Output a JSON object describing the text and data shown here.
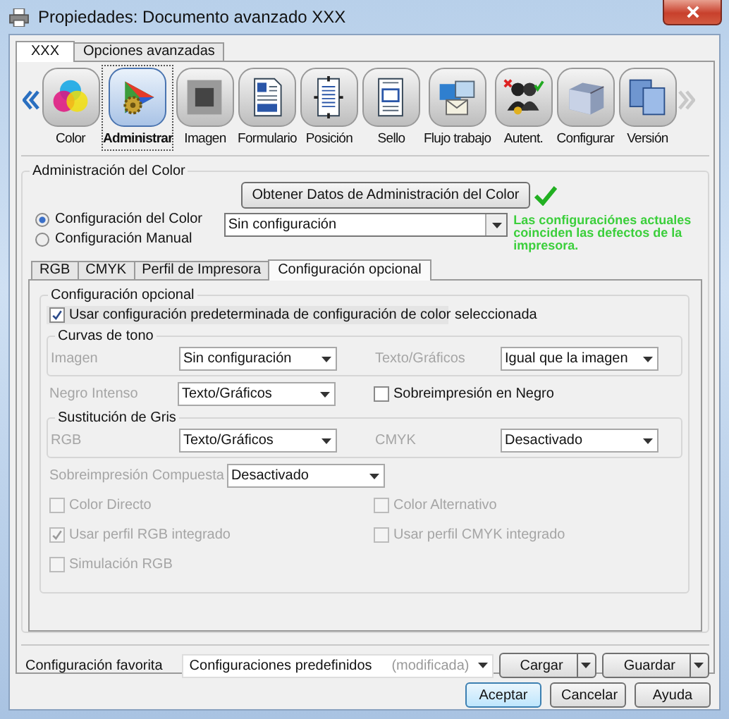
{
  "window": {
    "title": "Propiedades: Documento avanzado XXX"
  },
  "top_tabs": [
    {
      "label": "XXX",
      "selected": true
    },
    {
      "label": "Opciones avanzadas",
      "selected": false
    }
  ],
  "toolbar": {
    "items": [
      {
        "label": "Color",
        "selected": false
      },
      {
        "label": "Administrar",
        "selected": true
      },
      {
        "label": "Imagen",
        "selected": false
      },
      {
        "label": "Formulario",
        "selected": false
      },
      {
        "label": "Posición",
        "selected": false
      },
      {
        "label": "Sello",
        "selected": false
      },
      {
        "label": "Flujo trabajo",
        "selected": false
      },
      {
        "label": "Autent.",
        "selected": false
      },
      {
        "label": "Configurar",
        "selected": false
      },
      {
        "label": "Versión",
        "selected": false
      }
    ]
  },
  "color_management": {
    "title": "Administración del Color",
    "get_data_button": "Obtener Datos de Administración del Color",
    "modes": [
      {
        "label": "Configuración del Color",
        "selected": true
      },
      {
        "label": "Configuración Manual",
        "selected": false
      }
    ],
    "color_setting": "Sin configuración",
    "status_message": "Las configuraciónes actuales coinciden las defectos de la impresora.",
    "sub_tabs": [
      {
        "label": "RGB",
        "selected": false
      },
      {
        "label": "CMYK",
        "selected": false
      },
      {
        "label": "Perfil de Impresora",
        "selected": false
      },
      {
        "label": "Configuración opcional",
        "selected": true
      }
    ],
    "optional": {
      "title": "Configuración opcional",
      "use_default": {
        "label": "Usar configuración predeterminada de configuración de color seleccionada",
        "checked": true
      },
      "blocks": [
        {
          "kind": "group",
          "title": "Curvas de tono",
          "fields": [
            {
              "kind": "select",
              "label": "Imagen",
              "value": "Sin configuración",
              "disabled": true
            },
            {
              "kind": "select",
              "label": "Texto/Gráficos",
              "value": "Igual que la imagen",
              "disabled": true
            }
          ]
        },
        {
          "kind": "row",
          "fields": [
            {
              "kind": "select",
              "label": "Negro Intenso",
              "value": "Texto/Gráficos",
              "disabled": true
            },
            {
              "kind": "checkbox",
              "label": "Sobreimpresión en Negro",
              "checked": false,
              "disabled": false
            }
          ]
        },
        {
          "kind": "group",
          "title": "Sustitución de Gris",
          "fields": [
            {
              "kind": "select",
              "label": "RGB",
              "value": "Texto/Gráficos",
              "disabled": true
            },
            {
              "kind": "select",
              "label": "CMYK",
              "value": "Desactivado",
              "disabled": true
            }
          ]
        },
        {
          "kind": "row",
          "fields": [
            {
              "kind": "inline_select",
              "label": "Sobreimpresión Compuesta",
              "value": "Desactivado",
              "disabled": true
            }
          ]
        },
        {
          "kind": "row",
          "fields": [
            {
              "kind": "checkbox",
              "label": "Color Directo",
              "checked": false,
              "disabled": true
            },
            {
              "kind": "checkbox",
              "label": "Color Alternativo",
              "checked": false,
              "disabled": true
            }
          ]
        },
        {
          "kind": "row",
          "fields": [
            {
              "kind": "checkbox",
              "label": "Usar perfil RGB integrado",
              "checked": true,
              "disabled": true
            },
            {
              "kind": "checkbox",
              "label": "Usar perfil CMYK integrado",
              "checked": false,
              "disabled": true
            }
          ]
        },
        {
          "kind": "row",
          "fields": [
            {
              "kind": "checkbox",
              "label": "Simulación RGB",
              "checked": false,
              "disabled": true
            }
          ]
        }
      ]
    }
  },
  "favorites": {
    "label": "Configuración favorita",
    "value": "Configuraciones predefinidos",
    "note": "(modificada)",
    "buttons": [
      "Cargar",
      "Guardar"
    ]
  },
  "footer_buttons": [
    {
      "label": "Aceptar",
      "default": true
    },
    {
      "label": "Cancelar",
      "default": false
    },
    {
      "label": "Ayuda",
      "default": false
    }
  ]
}
